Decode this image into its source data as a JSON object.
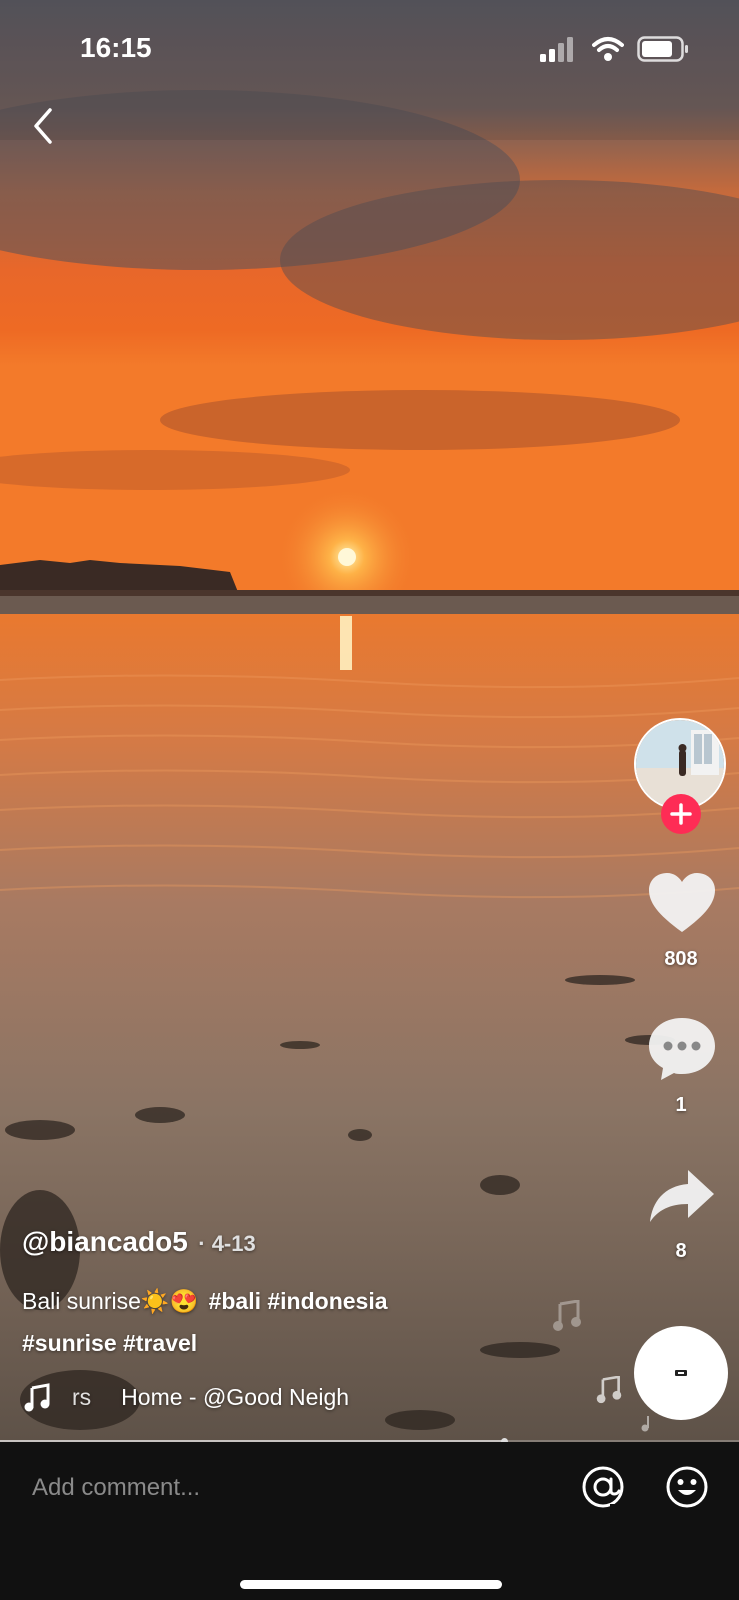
{
  "status_bar": {
    "time": "16:15"
  },
  "video": {
    "description": "Beach sunrise video frame"
  },
  "author": {
    "handle": "@biancado5",
    "date": "· 4-13"
  },
  "caption": {
    "line1_text": "Bali sunrise",
    "line1_emoji": "☀️😍",
    "line1_hashtags": "#bali #indonesia",
    "line2_hashtags": "#sunrise #travel"
  },
  "music": {
    "partial": "rs",
    "title": "Home - @Good Neigh"
  },
  "actions": {
    "like_count": "808",
    "comment_count": "1",
    "share_count": "8"
  },
  "comment_bar": {
    "placeholder": "Add comment..."
  },
  "colors": {
    "accent": "#fe2c55",
    "bar_bg": "#111111"
  },
  "icons": [
    "back-arrow-icon",
    "signal-icon",
    "wifi-icon",
    "battery-icon",
    "plus-icon",
    "heart-icon",
    "comment-icon",
    "share-icon",
    "music-note-icon",
    "at-icon",
    "emoji-icon",
    "music-disc-icon"
  ]
}
